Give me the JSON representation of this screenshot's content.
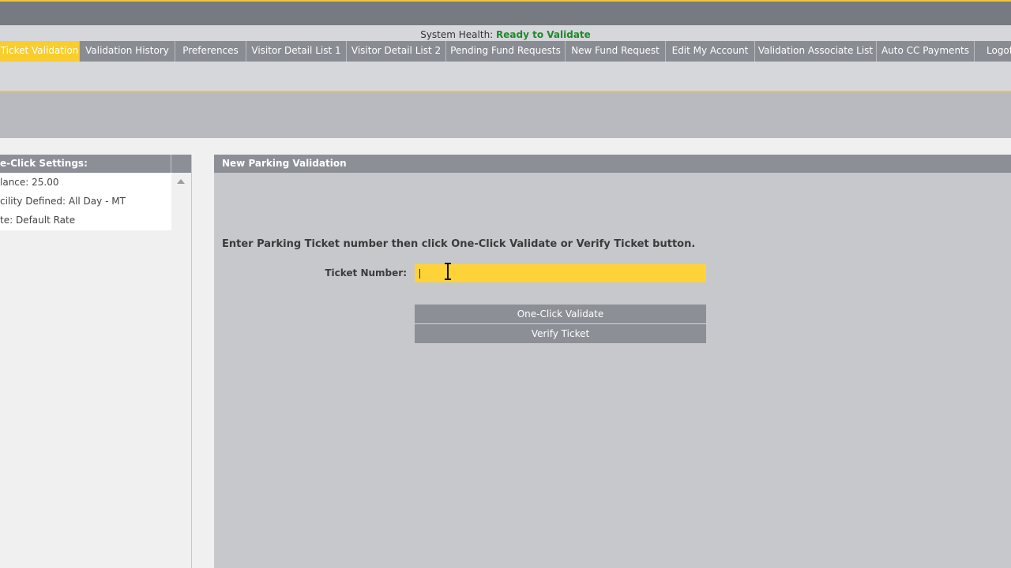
{
  "system_health": {
    "label": "System Health:",
    "value": "Ready to Validate",
    "value_color": "#1f8a2a"
  },
  "nav": {
    "active_color": "#f8cd2d",
    "tabs": [
      {
        "label": "Ticket Validation",
        "active": true
      },
      {
        "label": "Validation History"
      },
      {
        "label": "Preferences"
      },
      {
        "label": "Visitor Detail List 1"
      },
      {
        "label": "Visitor Detail List 2"
      },
      {
        "label": "Pending Fund Requests"
      },
      {
        "label": "New Fund Request"
      },
      {
        "label": "Edit My Account"
      },
      {
        "label": "Validation Associate List"
      },
      {
        "label": "Auto CC Payments"
      },
      {
        "label": "Logoff"
      }
    ]
  },
  "left_panel": {
    "title": "e-Click Settings:",
    "items": [
      "lance: 25.00",
      "cility Defined: All Day - MT",
      "te: Default Rate"
    ],
    "scroll_icon": "scroll-up-arrow-icon"
  },
  "main_panel": {
    "title": "New Parking Validation",
    "instructions": "Enter Parking Ticket number then click One-Click Validate or Verify Ticket button.",
    "ticket_label": "Ticket Number:",
    "ticket_value": "",
    "buttons": {
      "validate": "One-Click Validate",
      "verify": "Verify Ticket"
    },
    "cursor_icon": "text-cursor-icon"
  }
}
